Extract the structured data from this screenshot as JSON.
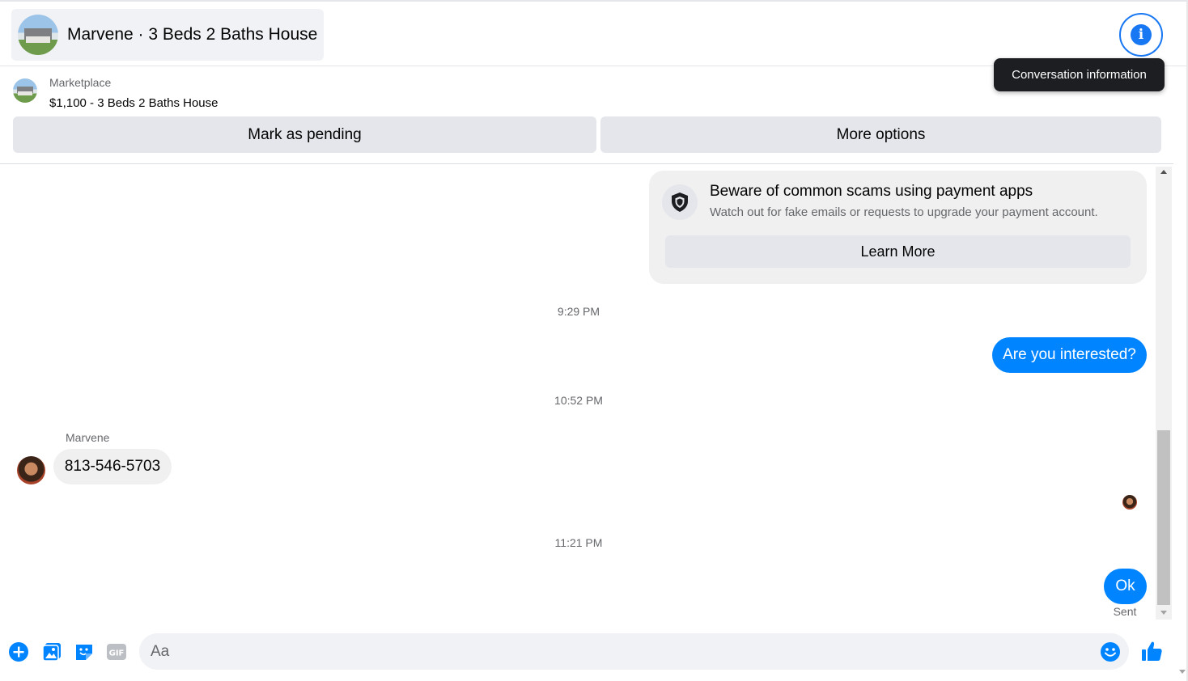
{
  "header": {
    "title": "Marvene · 3 Beds 2 Baths House",
    "info_button_icon": "info-icon",
    "tooltip": "Conversation information"
  },
  "marketplace": {
    "label": "Marketplace",
    "listing": "$1,100 - 3 Beds 2 Baths House",
    "mark_pending_label": "Mark as pending",
    "more_options_label": "More options"
  },
  "scam_notice": {
    "icon": "shield-icon",
    "title": "Beware of common scams using payment apps",
    "description": "Watch out for fake emails or requests to upgrade your payment account.",
    "button_label": "Learn More"
  },
  "messages": {
    "ts1": "9:29 PM",
    "out1": "Are you interested?",
    "ts2": "10:52 PM",
    "sender_name": "Marvene",
    "in1": "813-546-5703",
    "ts3": "11:21 PM",
    "out2": "Ok",
    "status": "Sent"
  },
  "composer": {
    "placeholder": "Aa",
    "icons": [
      "plus-circle-icon",
      "photo-icon",
      "sticker-icon",
      "gif-icon",
      "emoji-icon",
      "thumbs-up-icon"
    ]
  },
  "colors": {
    "accent": "#0084ff",
    "brand_blue": "#1877f2",
    "bubble_in": "#f0f0f0",
    "button_gray": "#e4e6eb",
    "tooltip_bg": "#1c1e21"
  }
}
